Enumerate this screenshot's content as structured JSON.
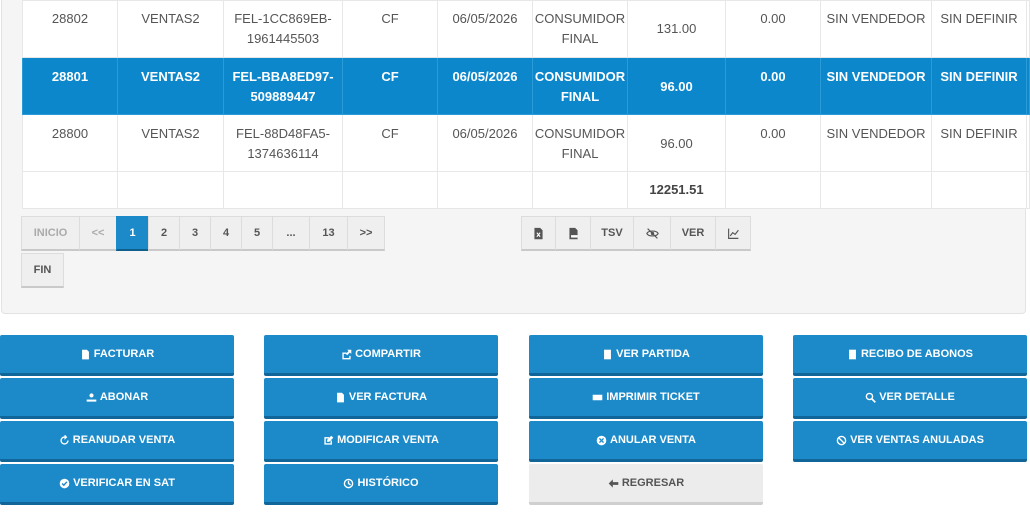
{
  "rows": [
    {
      "id": "28802",
      "serie": "VENTAS2",
      "doc1": "FEL-1CC869EB-",
      "doc2": "1961445503",
      "nit": "CF",
      "fecha": "06/05/2026",
      "cliente1": "CONSUMIDOR",
      "cliente2": "FINAL",
      "total": "131.00",
      "saldo": "0.00",
      "vendedor": "SIN VENDEDOR",
      "estado": "SIN DEFINIR"
    },
    {
      "id": "28801",
      "serie": "VENTAS2",
      "doc1": "FEL-BBA8ED97-",
      "doc2": "509889447",
      "nit": "CF",
      "fecha": "06/05/2026",
      "cliente1": "CONSUMIDOR",
      "cliente2": "FINAL",
      "total": "96.00",
      "saldo": "0.00",
      "vendedor": "SIN VENDEDOR",
      "estado": "SIN DEFINIR"
    },
    {
      "id": "28800",
      "serie": "VENTAS2",
      "doc1": "FEL-88D48FA5-",
      "doc2": "1374636114",
      "nit": "CF",
      "fecha": "06/05/2026",
      "cliente1": "CONSUMIDOR",
      "cliente2": "FINAL",
      "total": "96.00",
      "saldo": "0.00",
      "vendedor": "SIN VENDEDOR",
      "estado": "SIN DEFINIR"
    }
  ],
  "selected_row_id": "28801",
  "grand_total": "12251.51",
  "pagination": {
    "first": "INICIO",
    "prev": "<<",
    "pages": [
      "1",
      "2",
      "3",
      "4",
      "5",
      "...",
      "13"
    ],
    "current_page": "1",
    "next": ">>",
    "last": "FIN"
  },
  "export_tools": {
    "excel_icon": "file-excel-icon",
    "pdf_icon": "file-pdf-icon",
    "tsv": "TSV",
    "hide_icon": "eye-slash-icon",
    "ver": "VER",
    "chart_icon": "line-chart-icon"
  },
  "actions": {
    "facturar": "FACTURAR",
    "compartir": "COMPARTIR",
    "ver_partida": "VER PARTIDA",
    "recibo_abonos": "RECIBO DE ABONOS",
    "abonar": "ABONAR",
    "ver_factura": "VER FACTURA",
    "imprimir_ticket": "IMPRIMIR TICKET",
    "ver_detalle": "VER DETALLE",
    "reanudar_venta": "REANUDAR VENTA",
    "modificar_venta": "MODIFICAR VENTA",
    "anular_venta": "ANULAR VENTA",
    "ver_ventas_anuladas": "VER VENTAS ANULADAS",
    "verificar_sat": "VERIFICAR EN SAT",
    "historico": "HISTÓRICO",
    "regresar": "REGRESAR"
  },
  "colors": {
    "primary": "#1c8ac8",
    "selected_row": "#0d87cc",
    "neutral_button": "#ececec"
  }
}
